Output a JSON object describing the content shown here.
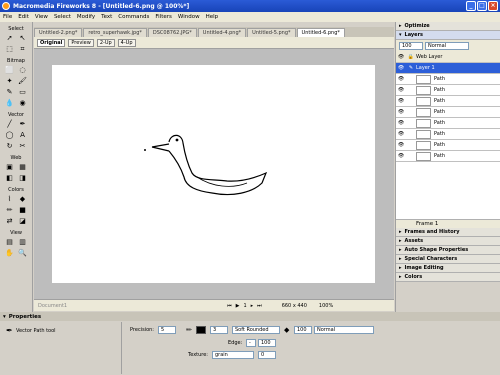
{
  "window": {
    "title": "Macromedia Fireworks 8 - [Untitled-6.png @ 100%*]"
  },
  "menu": [
    "File",
    "Edit",
    "View",
    "Select",
    "Modify",
    "Text",
    "Commands",
    "Filters",
    "Window",
    "Help"
  ],
  "toolbox": {
    "sections": [
      "Select",
      "Bitmap",
      "Vector",
      "Web",
      "Colors",
      "View"
    ]
  },
  "doc_tabs": [
    "Untitled-2.png*",
    "retro_superhawk.jpg*",
    "DSC08762.JPG*",
    "Untitled-4.png*",
    "Untitled-5.png*",
    "Untitled-6.png*"
  ],
  "view_modes": {
    "original": "Original",
    "preview": "Preview",
    "two_up": "2-Up",
    "four_up": "4-Up"
  },
  "status": {
    "doc_name": "Document1",
    "page": "1",
    "size": "660 x 440",
    "zoom": "100%"
  },
  "panels": {
    "optimize": "Optimize",
    "layers": "Layers",
    "opacity": "100",
    "blend": "Normal",
    "web_layer": "Web Layer",
    "layer1": "Layer 1",
    "path_items": [
      "Path",
      "Path",
      "Path",
      "Path",
      "Path",
      "Path",
      "Path",
      "Path"
    ],
    "frame": "Frame 1",
    "collapsed": [
      "Frames and History",
      "Assets",
      "Auto Shape Properties",
      "Special Characters",
      "Image Editing",
      "Colors"
    ]
  },
  "properties": {
    "header": "Properties",
    "tool_name": "Vector Path tool",
    "precision_label": "Precision:",
    "precision": "5",
    "stroke_size": "3",
    "stroke_type": "Soft Rounded",
    "edge_label": "Edge:",
    "edge": "100",
    "texture_label": "Texture:",
    "texture": "grain",
    "texture_amount": "0",
    "opacity": "100",
    "blend": "Normal"
  },
  "colors": {
    "title_bar": "#1844b8",
    "selection": "#2d5fd8",
    "canvas": "#ffffff",
    "stroke": "#000000"
  }
}
